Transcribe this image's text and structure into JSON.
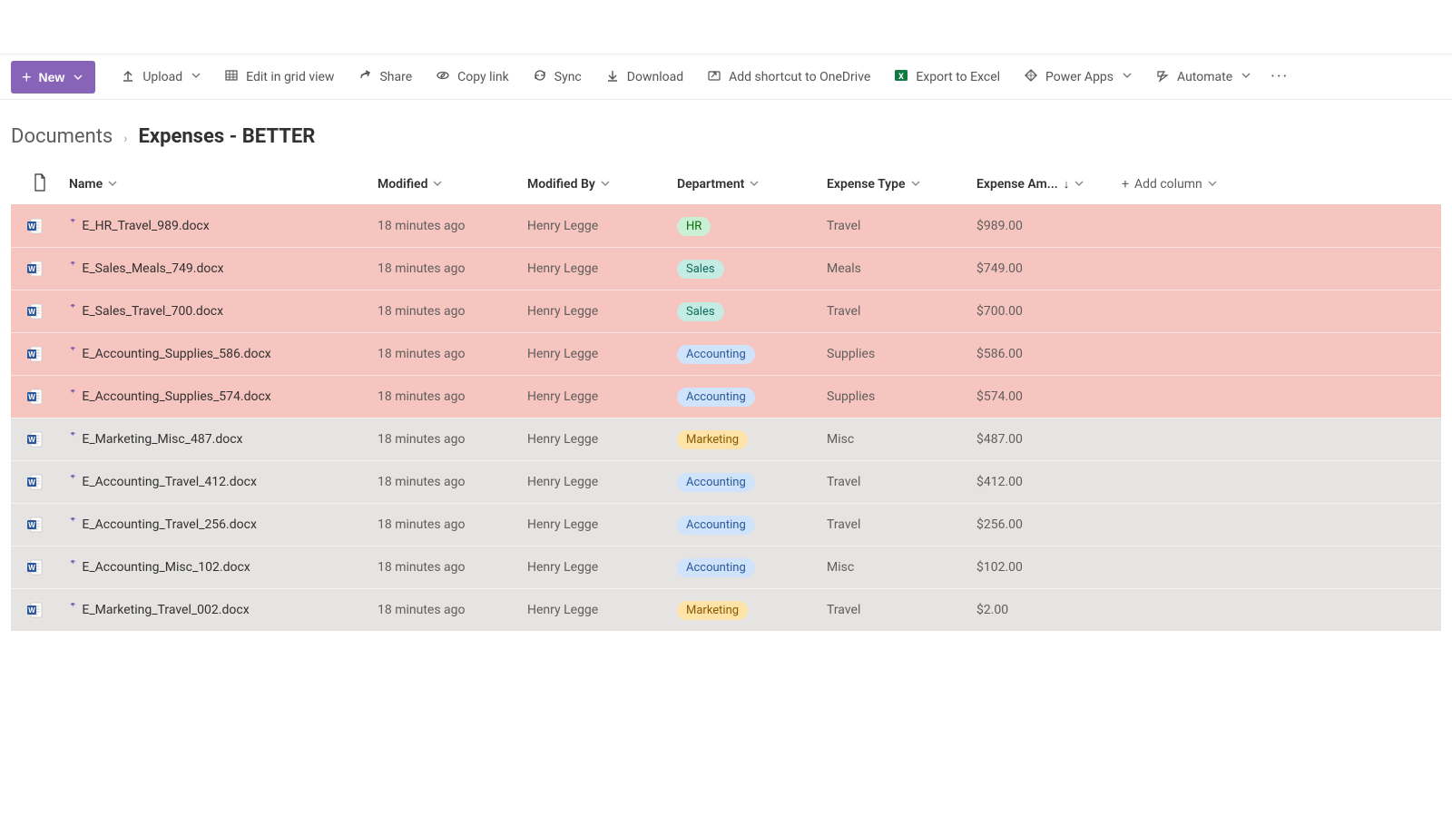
{
  "commandBar": {
    "new": "New",
    "upload": "Upload",
    "editGrid": "Edit in grid view",
    "share": "Share",
    "copyLink": "Copy link",
    "sync": "Sync",
    "download": "Download",
    "addShortcut": "Add shortcut to OneDrive",
    "exportExcel": "Export to Excel",
    "powerApps": "Power Apps",
    "automate": "Automate"
  },
  "breadcrumb": {
    "root": "Documents",
    "current": "Expenses - BETTER"
  },
  "columns": {
    "name": "Name",
    "modified": "Modified",
    "modifiedBy": "Modified By",
    "department": "Department",
    "expenseType": "Expense Type",
    "expenseAmount": "Expense Am...",
    "addColumn": "Add column"
  },
  "deptColors": {
    "HR": {
      "bg": "#c9f0d4",
      "fg": "#0b6a0b"
    },
    "Sales": {
      "bg": "#c5ece4",
      "fg": "#0f6b5c"
    },
    "Accounting": {
      "bg": "#cfe4fa",
      "fg": "#2b579a"
    },
    "Marketing": {
      "bg": "#fde3a7",
      "fg": "#8a5a00"
    }
  },
  "rows": [
    {
      "name": "E_HR_Travel_989.docx",
      "modified": "18 minutes ago",
      "modifiedBy": "Henry Legge",
      "department": "HR",
      "expenseType": "Travel",
      "amount": "$989.00",
      "highlight": true
    },
    {
      "name": "E_Sales_Meals_749.docx",
      "modified": "18 minutes ago",
      "modifiedBy": "Henry Legge",
      "department": "Sales",
      "expenseType": "Meals",
      "amount": "$749.00",
      "highlight": true
    },
    {
      "name": "E_Sales_Travel_700.docx",
      "modified": "18 minutes ago",
      "modifiedBy": "Henry Legge",
      "department": "Sales",
      "expenseType": "Travel",
      "amount": "$700.00",
      "highlight": true
    },
    {
      "name": "E_Accounting_Supplies_586.docx",
      "modified": "18 minutes ago",
      "modifiedBy": "Henry Legge",
      "department": "Accounting",
      "expenseType": "Supplies",
      "amount": "$586.00",
      "highlight": true
    },
    {
      "name": "E_Accounting_Supplies_574.docx",
      "modified": "18 minutes ago",
      "modifiedBy": "Henry Legge",
      "department": "Accounting",
      "expenseType": "Supplies",
      "amount": "$574.00",
      "highlight": true
    },
    {
      "name": "E_Marketing_Misc_487.docx",
      "modified": "18 minutes ago",
      "modifiedBy": "Henry Legge",
      "department": "Marketing",
      "expenseType": "Misc",
      "amount": "$487.00",
      "highlight": false
    },
    {
      "name": "E_Accounting_Travel_412.docx",
      "modified": "18 minutes ago",
      "modifiedBy": "Henry Legge",
      "department": "Accounting",
      "expenseType": "Travel",
      "amount": "$412.00",
      "highlight": false
    },
    {
      "name": "E_Accounting_Travel_256.docx",
      "modified": "18 minutes ago",
      "modifiedBy": "Henry Legge",
      "department": "Accounting",
      "expenseType": "Travel",
      "amount": "$256.00",
      "highlight": false
    },
    {
      "name": "E_Accounting_Misc_102.docx",
      "modified": "18 minutes ago",
      "modifiedBy": "Henry Legge",
      "department": "Accounting",
      "expenseType": "Misc",
      "amount": "$102.00",
      "highlight": false
    },
    {
      "name": "E_Marketing_Travel_002.docx",
      "modified": "18 minutes ago",
      "modifiedBy": "Henry Legge",
      "department": "Marketing",
      "expenseType": "Travel",
      "amount": "$2.00",
      "highlight": false
    }
  ]
}
